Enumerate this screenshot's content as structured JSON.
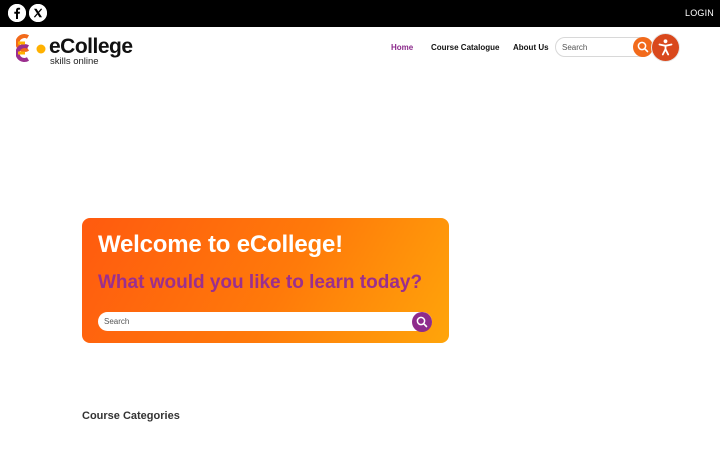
{
  "topbar": {
    "social": [
      {
        "icon": "facebook-icon",
        "label": "Facebook"
      },
      {
        "icon": "x-icon",
        "label": "X"
      }
    ],
    "login_label": "LOGIN"
  },
  "logo": {
    "title": "eCollege",
    "subtitle": "skills online"
  },
  "nav": {
    "items": [
      {
        "label": "Home",
        "active": true
      },
      {
        "label": "Course Catalogue",
        "active": false
      },
      {
        "label": "About Us",
        "active": false
      }
    ],
    "search_placeholder": "Search",
    "accessibility_icon": "accessibility-icon"
  },
  "hero": {
    "title": "Welcome to eCollege!",
    "subtitle": "What would you like to learn today?",
    "search_placeholder": "Search"
  },
  "section": {
    "title": "Course Categories"
  },
  "colors": {
    "accent_orange": "#f26a1b",
    "accent_purple": "#8e2b8c",
    "hero_gradient_start": "#ff5a0f",
    "hero_gradient_end": "#ffa50a"
  }
}
